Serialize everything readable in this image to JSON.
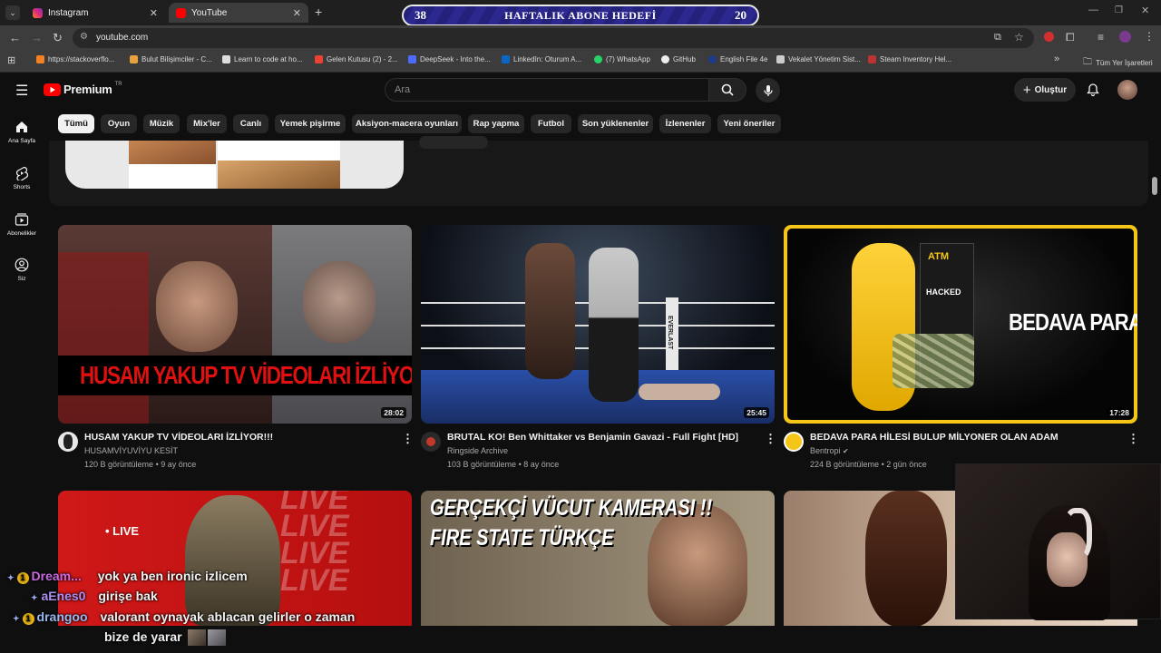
{
  "browser": {
    "tabs": [
      {
        "label": "Instagram",
        "active": false
      },
      {
        "label": "YouTube",
        "active": true
      }
    ],
    "url": "youtube.com",
    "bookmarks": [
      "https://stackoverflo...",
      "Bulut Bilişimciler - C...",
      "Learn to code at ho...",
      "Gelen Kutusu (2) - 2...",
      "DeepSeek - Into the...",
      "LinkedIn: Oturum A...",
      "(7) WhatsApp",
      "GitHub",
      "English File 4e",
      "Vekalet Yönetim Sist...",
      "Steam Inventory Hel..."
    ],
    "bookmarks_folder": "Tüm Yer İşaretleri"
  },
  "overlay": {
    "left_number": "38",
    "title": "HAFTALIK ABONE HEDEFİ",
    "right_number": "20"
  },
  "youtube": {
    "logo_text": "Premium",
    "logo_sup": "TR",
    "search_placeholder": "Ara",
    "create_label": "Oluştur",
    "sidebar": [
      {
        "label": "Ana Sayfa",
        "icon": "home-icon"
      },
      {
        "label": "Shorts",
        "icon": "shorts-icon"
      },
      {
        "label": "Abonelikler",
        "icon": "subscriptions-icon"
      },
      {
        "label": "Siz",
        "icon": "account-icon"
      }
    ],
    "chips": [
      "Tümü",
      "Oyun",
      "Müzik",
      "Mix'ler",
      "Canlı",
      "Yemek pişirme",
      "Aksiyon-macera oyunları",
      "Rap yapma",
      "Futbol",
      "Son yüklenenler",
      "İzlenenler",
      "Yeni öneriler"
    ],
    "videos": [
      {
        "title": "HUSAM YAKUP TV VİDEOLARI İZLİYOR!!!",
        "channel": "HUSAMVİYUVİYU KESİT",
        "views": "120 B görüntüleme",
        "age": "9 ay önce",
        "duration": "28:02",
        "thumb_text": "HUSAM YAKUP TV VİDEOLARI İZLİYOR"
      },
      {
        "title": "BRUTAL KO! Ben Whittaker vs Benjamin Gavazi - Full Fight [HD]",
        "channel": "Ringside Archive",
        "views": "103 B görüntüleme",
        "age": "8 ay önce",
        "duration": "25:45",
        "thumb_text": "EVERLAST"
      },
      {
        "title": "BEDAVA PARA HİLESİ BULUP MİLYONER OLAN ADAM",
        "channel": "Bentropi",
        "views": "224 B görüntüleme",
        "age": "2 gün önce",
        "duration": "17:28",
        "thumb_text": "BEDAVA PARA",
        "atm_text": "ATM",
        "hacked_text": "HACKED"
      }
    ],
    "row2": [
      {
        "badge": "• LIVE",
        "bg_text": "LIVE"
      },
      {
        "thumb_title": "GERÇEKÇİ VÜCUT KAMERASI !!",
        "thumb_sub": "FIRE STATE TÜRKÇE"
      },
      {}
    ]
  },
  "chat": [
    {
      "name": "Dream...",
      "message": "yok ya ben ironic izlicem"
    },
    {
      "name": "aEnes0",
      "message": "girişe bak"
    },
    {
      "name": "drangoo",
      "message": "valorant oynayak ablacan gelirler o zaman"
    },
    {
      "name": "",
      "message": "bize de yarar"
    }
  ],
  "colors": {
    "yt_red": "#ff0000",
    "background": "#0f0f0f",
    "chip_bg": "#272727",
    "highlight_border": "#f5c518",
    "overlay_blue": "#2c2890"
  }
}
